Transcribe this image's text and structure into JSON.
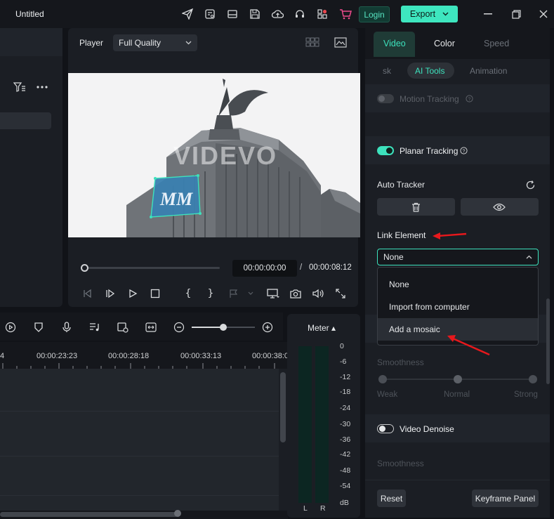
{
  "app": {
    "title": "Untitled",
    "login": "Login",
    "export": "Export"
  },
  "player": {
    "label": "Player",
    "quality": "Full Quality",
    "watermark": "VIDEVO",
    "current_time": "00:00:00:00",
    "separator": "/",
    "total_time": "00:00:08:12",
    "progress": 0
  },
  "timeline": {
    "ruler": [
      "4",
      "00:00:23:23",
      "00:00:28:18",
      "00:00:33:13",
      "00:00:38:0"
    ]
  },
  "meter": {
    "title": "Meter ▴",
    "scale": [
      "0",
      "-6",
      "-12",
      "-18",
      "-24",
      "-30",
      "-36",
      "-42",
      "-48",
      "-54",
      "dB"
    ],
    "left": "L",
    "right": "R"
  },
  "right": {
    "tabs": [
      "Video",
      "Color",
      "Speed"
    ],
    "subtabs": [
      "sk",
      "AI Tools",
      "Animation"
    ],
    "motion_tracking": "Motion Tracking",
    "planar_tracking": "Planar Tracking",
    "auto_tracker": "Auto Tracker",
    "link_element": "Link Element",
    "link_value": "None",
    "dropdown": [
      "None",
      "Import from computer",
      "Add a mosaic"
    ],
    "smoothness": "Smoothness",
    "smooth_levels": [
      "Weak",
      "Normal",
      "Strong"
    ],
    "video_denoise": "Video Denoise",
    "smoothness2": "Smoothness",
    "reset": "Reset",
    "keyframe": "Keyframe Panel"
  },
  "colors": {
    "accent": "#3ee6bf",
    "annotation": "#e8181c"
  }
}
